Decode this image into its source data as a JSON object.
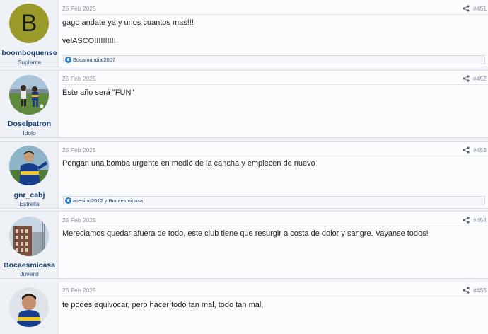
{
  "posts": [
    {
      "username": "boomboquense",
      "user_title": "Suplente",
      "avatar_letter": "B",
      "avatar_color": "#9a9a2a",
      "date": "25 Feb 2025",
      "number": "#451",
      "lines": [
        "gago andate ya y unos cuantos mas!!!",
        "velASCO!!!!!!!!!!"
      ],
      "reactions": "Bocamundial2007"
    },
    {
      "username": "Doselpatron",
      "user_title": "Idolo",
      "date": "25 Feb 2025",
      "number": "#452",
      "lines": [
        "Este año será \"FUN\""
      ]
    },
    {
      "username": "gnr_cabj",
      "user_title": "Estrella",
      "date": "25 Feb 2025",
      "number": "#453",
      "lines": [
        "Pongan una bomba urgente en medio de la cancha y empiecen de nuevo"
      ],
      "reactions": "asesino2612 y Bocaesmicasa"
    },
    {
      "username": "Bocaesmicasa",
      "user_title": "Juvenil",
      "date": "25 Feb 2025",
      "number": "#454",
      "lines": [
        "Mereciamos quedar afuera de todo, este club tiene que resurgir a costa de dolor y sangre. Vayanse todos!"
      ]
    },
    {
      "username": "",
      "user_title": "",
      "date": "25 Feb 2025",
      "number": "#455",
      "lines": [
        "te podes equivocar, pero hacer todo tan mal, todo tan mal,"
      ]
    }
  ],
  "icons": {
    "share": "share-icon",
    "like": "like-reaction-icon"
  }
}
